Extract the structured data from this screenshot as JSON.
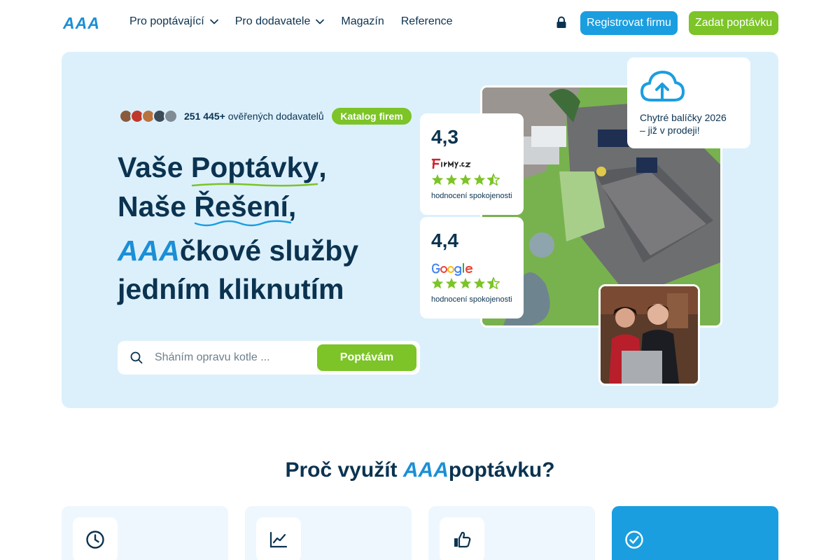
{
  "header": {
    "logo": "AAA",
    "nav": [
      {
        "label": "Pro poptávající",
        "has_dropdown": true
      },
      {
        "label": "Pro dodavatele",
        "has_dropdown": true
      },
      {
        "label": "Magazín",
        "has_dropdown": false
      },
      {
        "label": "Reference",
        "has_dropdown": false
      }
    ],
    "register_label": "Registrovat firmu",
    "request_label": "Zadat poptávku",
    "icons": {
      "lock": "lock-icon",
      "chevron": "chevron-down-icon"
    }
  },
  "hero": {
    "supplier_count": "251 445+",
    "supplier_text": "ověřených dodavatelů",
    "catalog_label": "Katalog firem",
    "headline": {
      "line1_prefix": "Vaše ",
      "line1_word": "Poptávky",
      "line1_suffix": ",",
      "line2_prefix": "Naše ",
      "line2_word": "Řešení",
      "line2_suffix": ",",
      "line3_brand": "AAA",
      "line3_rest": "čkové služby",
      "line4": "jedním kliknutím"
    },
    "search": {
      "placeholder": "Sháním opravu kotle ...",
      "button_label": "Poptávám"
    },
    "ratings": [
      {
        "score": "4,3",
        "source_logo": "firmy-cz-logo",
        "stars": 4.5,
        "label": "hodnocení spokojenosti"
      },
      {
        "score": "4,4",
        "source_logo": "google-logo",
        "stars": 4.5,
        "label": "hodnocení spokojenosti"
      }
    ],
    "promo": {
      "icon": "cloud-upload-icon",
      "line1": "Chytré balíčky 2026",
      "line2": "– již v prodeji!"
    }
  },
  "why": {
    "title_prefix": "Proč využít ",
    "title_brand": "AAA",
    "title_suffix": "poptávku?",
    "cards": [
      {
        "icon": "clock-icon",
        "active": false
      },
      {
        "icon": "line-chart-icon",
        "active": false
      },
      {
        "icon": "thumbs-up-icon",
        "active": false
      },
      {
        "icon": "check-circle-icon",
        "active": true
      }
    ]
  },
  "colors": {
    "brand_blue": "#1a9ee0",
    "brand_green": "#7cc427",
    "navy": "#0b3350",
    "hero_bg": "#dcf0fc",
    "star": "#7cc427"
  }
}
